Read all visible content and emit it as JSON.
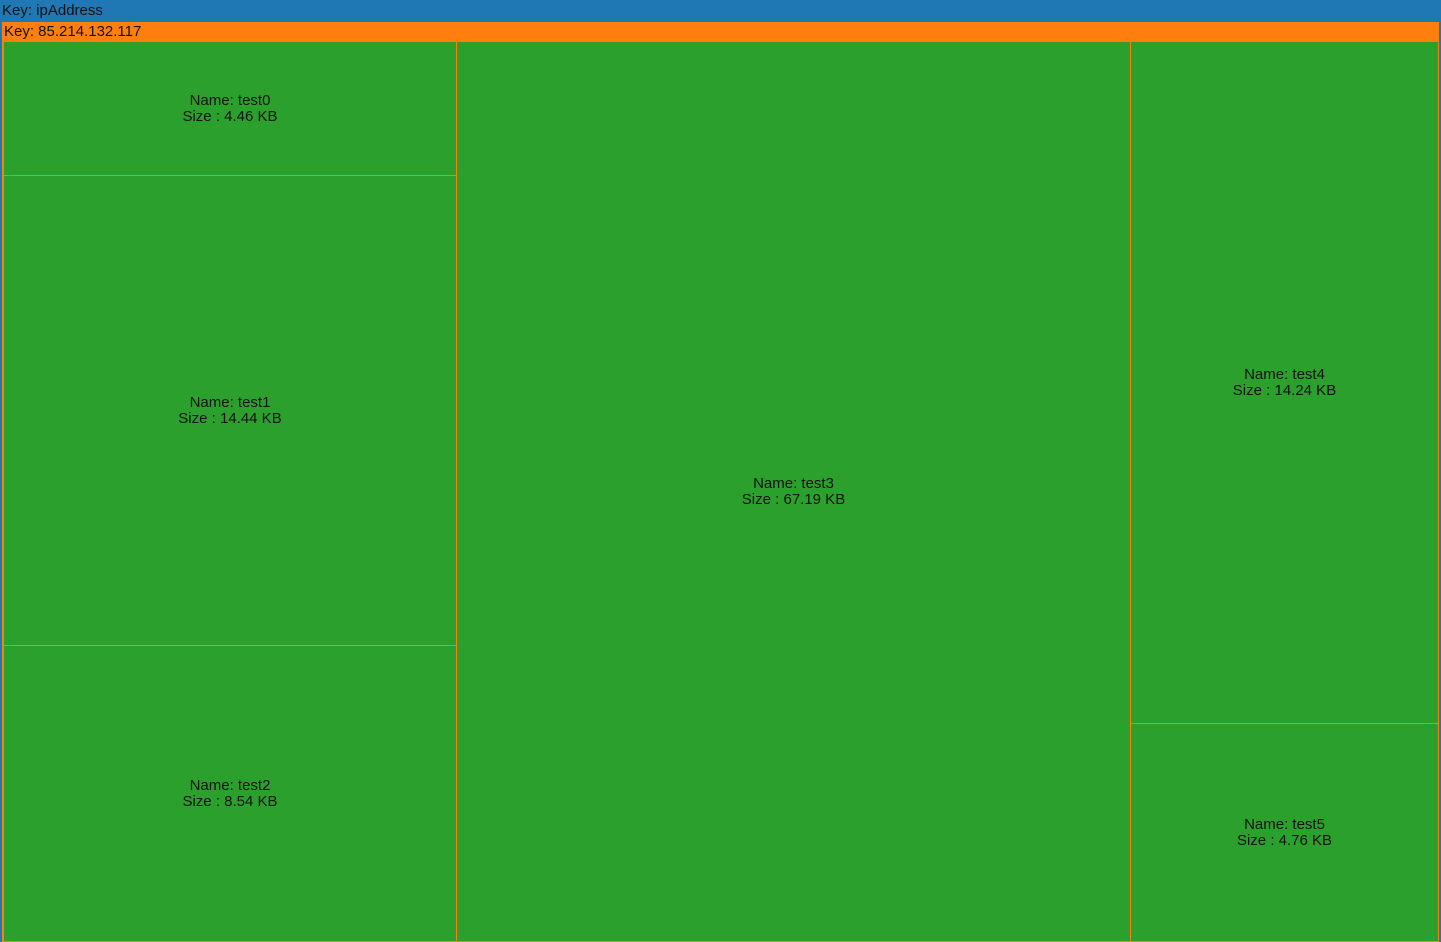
{
  "treemap": {
    "root_label": "Key: ipAddress",
    "group_label": "Key: 85.214.132.117",
    "colors": {
      "root": "#1f77b4",
      "group": "#ff7f0e",
      "leaf": "#2ca02c"
    },
    "items": [
      {
        "name": "Name: test0",
        "size": "Size : 4.46 KB"
      },
      {
        "name": "Name: test1",
        "size": "Size : 14.44 KB"
      },
      {
        "name": "Name: test2",
        "size": "Size : 8.54 KB"
      },
      {
        "name": "Name: test3",
        "size": "Size : 67.19 KB"
      },
      {
        "name": "Name: test4",
        "size": "Size : 14.24 KB"
      },
      {
        "name": "Name: test5",
        "size": "Size : 4.76 KB"
      }
    ]
  }
}
